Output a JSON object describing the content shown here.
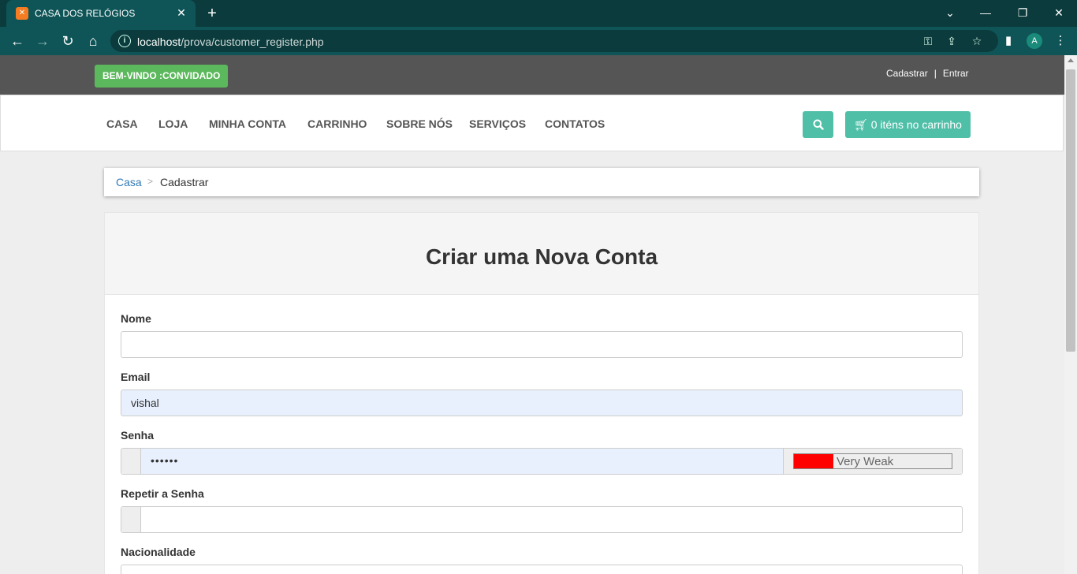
{
  "browser": {
    "tab_title": "CASA DOS RELÓGIOS",
    "tab_favicon": "xampp-icon",
    "url_host": "localhost",
    "url_path": "/prova/customer_register.php",
    "profile_initial": "A"
  },
  "topbar": {
    "welcome": "BEM-VINDO :CONVIDADO",
    "link_register": "Cadastrar",
    "separator": "|",
    "link_login": "Entrar"
  },
  "nav": {
    "items": [
      "CASA",
      "LOJA",
      "MINHA CONTA",
      "CARRINHO",
      "SOBRE NÓS",
      "SERVIÇOS",
      "CONTATOS"
    ],
    "cart_label": "0 iténs no carrinho"
  },
  "breadcrumb": {
    "home": "Casa",
    "separator": ">",
    "current": "Cadastrar"
  },
  "form": {
    "title": "Criar uma Nova Conta",
    "name_label": "Nome",
    "name_value": "",
    "email_label": "Email",
    "email_value": "vishal",
    "password_label": "Senha",
    "password_value": "••••••",
    "strength_label": "Very Weak",
    "strength_level": 0.25,
    "repeat_label": "Repetir a Senha",
    "repeat_value": "",
    "nationality_label": "Nacionalidade"
  },
  "colors": {
    "accent": "#4fbfa8",
    "welcome_bg": "#5cb85c",
    "topbar_bg": "#555555",
    "strength_fill": "#ff0000"
  }
}
